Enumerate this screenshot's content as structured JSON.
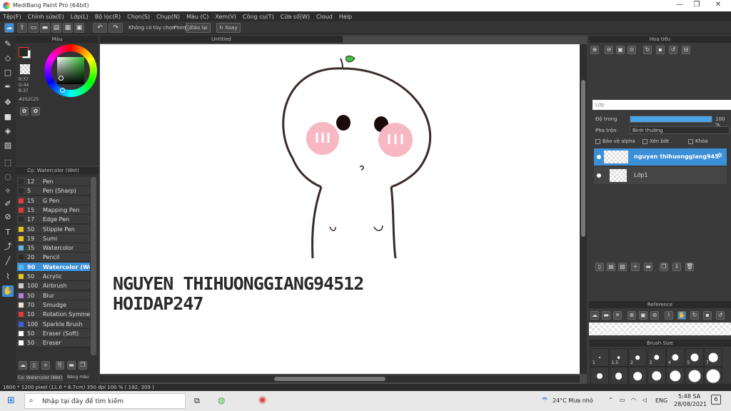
{
  "window": {
    "title": "MediBang Paint Pro (64bit)",
    "minimize": "—",
    "maximize": "❐",
    "close": "✕"
  },
  "menu": [
    "Tệp(F)",
    "Chỉnh sửa(E)",
    "Lớp(L)",
    "Bộ lọc(R)",
    "Chọn(S)",
    "Chụp(N)",
    "Màu (C)",
    "Xem(V)",
    "Công cụ(T)",
    "Cửa sổ(W)",
    "Cloud",
    "Help"
  ],
  "toolbar": {
    "no_option": "Không có tùy chọn",
    "phim": "Phím",
    "dao_lai": "Đảo lại",
    "xoay": "Xoay"
  },
  "color_panel": {
    "title": "Màu",
    "r": "R:37",
    "g": "G:44",
    "b": "B:37",
    "hex": "#252C25",
    "fg_color": "#252c25",
    "bg_color": "#ffffff"
  },
  "brush_panel": {
    "title": "Cọ: Watercolor (Wet)",
    "brushes": [
      {
        "size": "12",
        "name": "Pen",
        "color": "#2b2b2b"
      },
      {
        "size": "5",
        "name": "Pen (Sharp)",
        "color": "#2b2b2b"
      },
      {
        "size": "15",
        "name": "G Pen",
        "color": "#e23b3b"
      },
      {
        "size": "15",
        "name": "Mapping Pen",
        "color": "#e23b3b"
      },
      {
        "size": "17",
        "name": "Edge Pen",
        "color": "#2b2b2b"
      },
      {
        "size": "50",
        "name": "Stipple Pen",
        "color": "#e8c51c"
      },
      {
        "size": "19",
        "name": "Sumi",
        "color": "#e8c51c"
      },
      {
        "size": "35",
        "name": "Watercolor",
        "color": "#5bb8e8"
      },
      {
        "size": "20",
        "name": "Pencil",
        "color": "#2b2b2b"
      },
      {
        "size": "90",
        "name": "Watercolor (We",
        "color": "#5bb8e8"
      },
      {
        "size": "50",
        "name": "Acrylic",
        "color": "#e8c51c"
      },
      {
        "size": "100",
        "name": "Airbrush",
        "color": "#cfcfcf"
      },
      {
        "size": "50",
        "name": "Blur",
        "color": "#b57be8"
      },
      {
        "size": "70",
        "name": "Smudge",
        "color": "#f0e4d4"
      },
      {
        "size": "10",
        "name": "Rotation Symmetr",
        "color": "#e23b3b"
      },
      {
        "size": "100",
        "name": "Sparkle Brush",
        "color": "#3b5fe2"
      },
      {
        "size": "50",
        "name": "Eraser (Soft)",
        "color": "#ffffff"
      },
      {
        "size": "50",
        "name": "Eraser",
        "color": "#ffffff"
      }
    ],
    "tab1": "Cọ: Watercolor (Wet)",
    "tab2": "Bảng màu"
  },
  "canvas": {
    "tab": "Untitled",
    "text_line1": "NGUYEN THIHUONGGIANG94512",
    "text_line2": "HOIDAP247"
  },
  "navigator": {
    "title": "Hoa tiêu"
  },
  "layers": {
    "title": "Lớp",
    "opacity_label": "Độ trong",
    "opacity_value": "100 %",
    "opacity_fraction": 1.0,
    "blend_label": "Pha trộn",
    "blend_value": "Bình thường",
    "protect_alpha": "Bảo vệ alpha",
    "clipping": "Xén bớt",
    "lock": "Khóa",
    "items": [
      {
        "name": "nguyen thihuonggiang945",
        "selected": true
      },
      {
        "name": "Lớp1",
        "selected": false
      }
    ]
  },
  "reference": {
    "title": "Reference"
  },
  "brush_size": {
    "title": "Brush Size",
    "sizes": [
      "1",
      "1.5",
      "2",
      "3",
      "4",
      "5",
      "7"
    ]
  },
  "status": {
    "text": "1600 * 1200 pixel   (11.6 * 8.7cm)   350 dpi   100 %   ( 192, 309 )"
  },
  "taskbar": {
    "search_placeholder": "Nhập tại đây để tìm kiếm",
    "weather": "24°C  Mưa nhỏ",
    "lang": "ENG",
    "time": "5:48 SA",
    "date": "28/08/2021",
    "notif": "6"
  }
}
